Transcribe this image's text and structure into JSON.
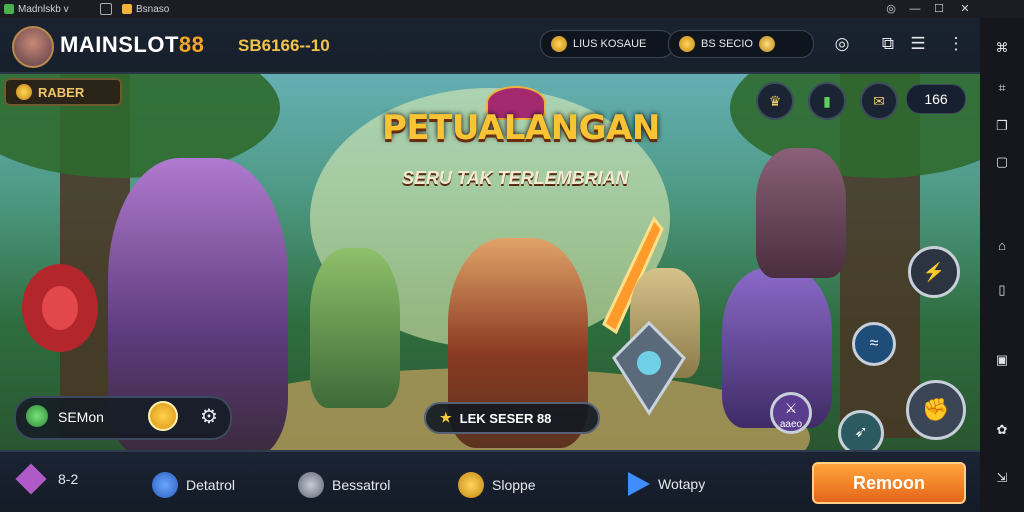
{
  "window": {
    "tab1_label": "Madnlskb v",
    "tab2_label": "Bsnaso",
    "controls": {
      "minimize": "—",
      "restore": "☐",
      "close": "✕",
      "rec": "◎"
    }
  },
  "header": {
    "brand_main": "MAINSLOT",
    "brand_num": "88",
    "coins": "SB6166--10",
    "pill1_label": "LIUS KOSAUE",
    "pill2_label": "BS SECIO",
    "icons": [
      "target-icon",
      "screenshot-icon",
      "grid-icon"
    ]
  },
  "left_badge": {
    "label": "RABER"
  },
  "banner": {
    "title_line1": "PETUALANGAN",
    "title_line2": "SERU TAK TERLEMBRIAN"
  },
  "top_right": {
    "count": "166"
  },
  "stat_pill": {
    "label": "SEMon"
  },
  "center_pill": {
    "label": "LEK SESER 88"
  },
  "skill_badge": {
    "label": "aaeo"
  },
  "bottom_nav": [
    {
      "label": "8-2"
    },
    {
      "label": "Detatrol"
    },
    {
      "label": "Bessatrol"
    },
    {
      "label": "Sloppe"
    },
    {
      "label": "Wotapy"
    }
  ],
  "cta": {
    "label": "Remoon"
  },
  "colors": {
    "accent": "#f6a623",
    "cta": "#ff8a2a",
    "bar": "#1a2230"
  }
}
